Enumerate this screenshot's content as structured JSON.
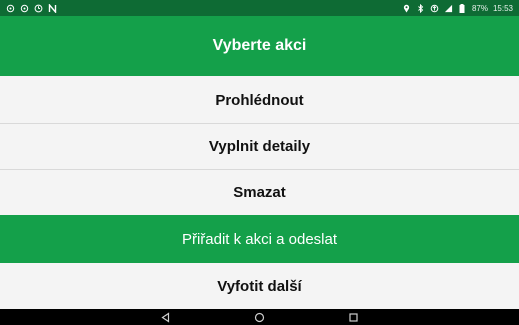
{
  "status_bar": {
    "left_icons": [
      "signal-indicator-icon",
      "signal-indicator-icon",
      "alarm-icon",
      "nfc-icon"
    ],
    "right_icons": [
      "location-icon",
      "bluetooth-icon",
      "data-transfer-icon",
      "signal-strength-icon",
      "battery-icon"
    ],
    "battery": "87%",
    "time": "15:53"
  },
  "header": {
    "title": "Vyberte akci"
  },
  "actions": [
    {
      "label": "Prohlédnout",
      "highlighted": false
    },
    {
      "label": "Vyplnit detaily",
      "highlighted": false
    },
    {
      "label": "Smazat",
      "highlighted": false
    },
    {
      "label": "Přiřadit k akci a odeslat",
      "highlighted": true
    },
    {
      "label": "Vyfotit další",
      "highlighted": false
    }
  ],
  "nav_bar": {
    "buttons": [
      "back-icon",
      "home-icon",
      "recents-icon"
    ]
  },
  "colors": {
    "primary_green": "#14a04a",
    "status_bar_green": "#0e6b34",
    "row_background": "#f4f4f4",
    "nav_bar": "#000000"
  }
}
